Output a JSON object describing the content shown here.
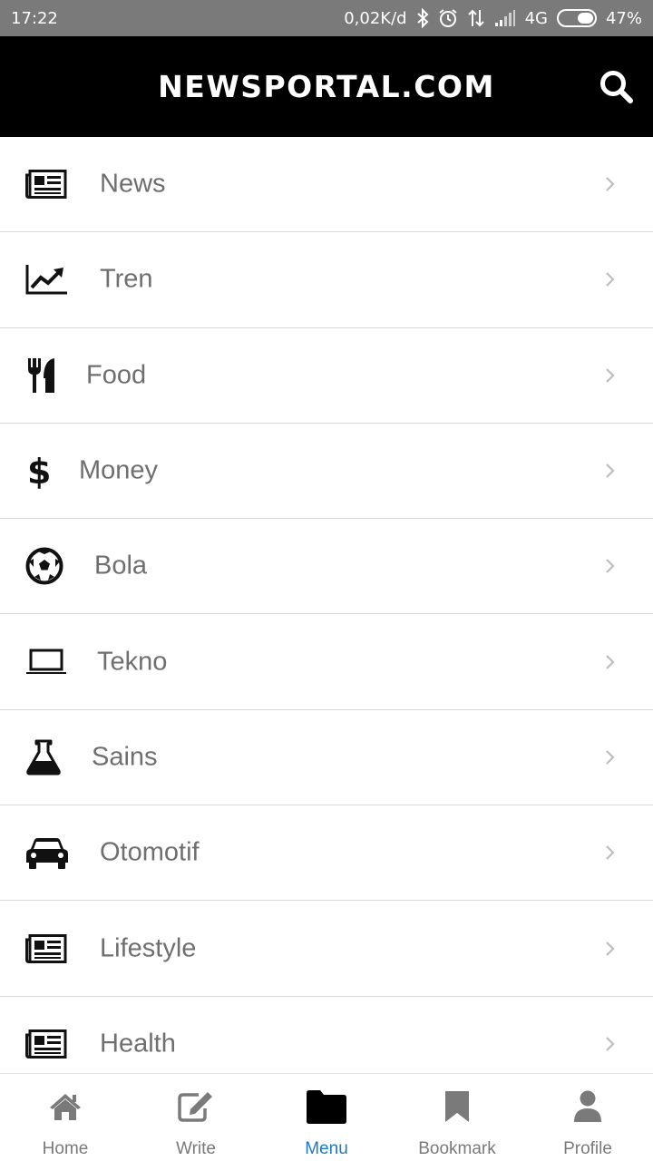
{
  "status_bar": {
    "time": "17:22",
    "net_speed": "0,02K/d",
    "network": "4G",
    "battery": "47%",
    "battery_level": 0.47,
    "icons": [
      "bluetooth-icon",
      "alarm-icon",
      "data-transfer-icon",
      "signal-icon",
      "battery-icon"
    ]
  },
  "header": {
    "title": "NEWSPORTAL.COM",
    "search_icon": "search-icon"
  },
  "menu": {
    "items": [
      {
        "label": "News",
        "icon": "newspaper-icon"
      },
      {
        "label": "Tren",
        "icon": "trend-chart-icon"
      },
      {
        "label": "Food",
        "icon": "utensils-icon"
      },
      {
        "label": "Money",
        "icon": "dollar-icon"
      },
      {
        "label": "Bola",
        "icon": "soccer-ball-icon"
      },
      {
        "label": "Tekno",
        "icon": "laptop-icon"
      },
      {
        "label": "Sains",
        "icon": "flask-icon"
      },
      {
        "label": "Otomotif",
        "icon": "car-icon"
      },
      {
        "label": "Lifestyle",
        "icon": "newspaper-icon"
      },
      {
        "label": "Health",
        "icon": "newspaper-icon"
      }
    ]
  },
  "bottom_nav": {
    "items": [
      {
        "label": "Home",
        "icon": "home-icon"
      },
      {
        "label": "Write",
        "icon": "edit-icon"
      },
      {
        "label": "Menu",
        "icon": "folder-icon",
        "active": true
      },
      {
        "label": "Bookmark",
        "icon": "bookmark-icon"
      },
      {
        "label": "Profile",
        "icon": "user-icon"
      }
    ]
  },
  "colors": {
    "status_bar_bg": "#7a7a7a",
    "header_bg": "#000000",
    "label_text": "#6f6f6f",
    "active_tab": "#1e78c8",
    "inactive_tab": "#7a7a7a"
  }
}
